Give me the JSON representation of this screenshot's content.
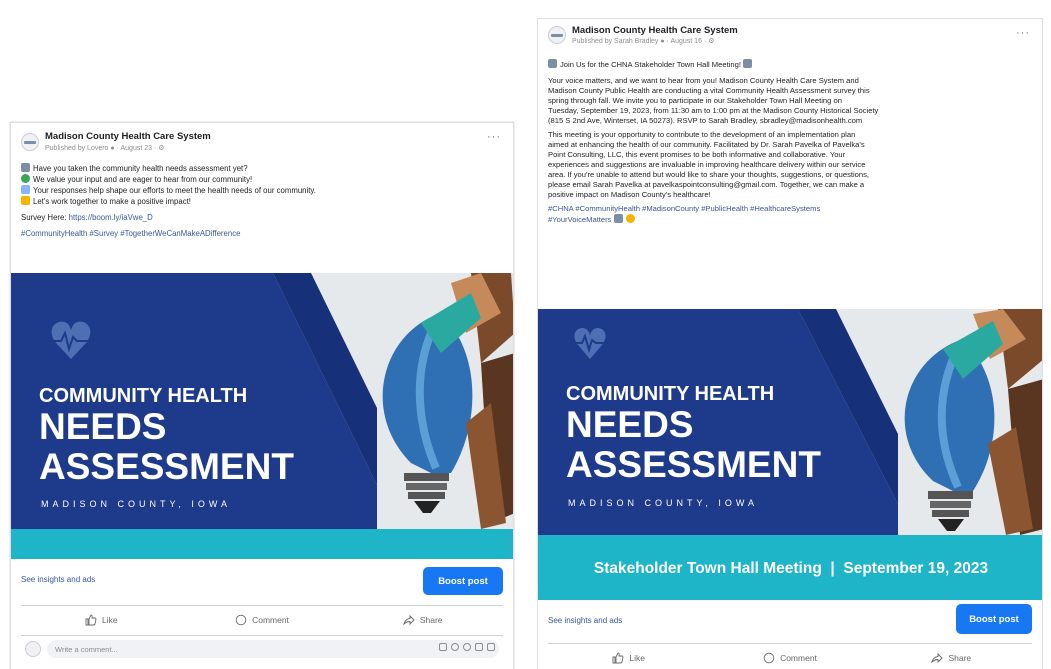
{
  "post1": {
    "page_name": "Madison County Health Care System",
    "published": "Published by",
    "publisher": "Lovero",
    "date": "August 23",
    "more": "···",
    "lines": [
      "Have you taken the community health needs assessment yet?",
      "We value your input and are eager to hear from our community!",
      "Your responses help shape our efforts to meet the health needs of our community.",
      "Let's work together to make a positive impact!"
    ],
    "survey_label": "Survey Here:",
    "survey_link": "https://boom.ly/iaVwe_D",
    "hashtags": "#CommunityHealth #Survey #TogetherWeCanMakeADifference",
    "banner": {
      "line1": "COMMUNITY HEALTH",
      "line2": "NEEDS",
      "line3": "ASSESSMENT",
      "line4": "MADISON COUNTY, IOWA"
    },
    "insights": "See insights and ads",
    "boost": "Boost post",
    "like": "Like",
    "comment": "Comment",
    "share": "Share",
    "comment_placeholder": "Write a comment..."
  },
  "post2": {
    "page_name": "Madison County Health Care System",
    "published": "Published by",
    "publisher": "Sarah Bradley",
    "date": "August 16",
    "more": "···",
    "headline": "Join Us for the CHNA Stakeholder Town Hall Meeting!",
    "para1": [
      "Your voice matters, and we want to hear from you! Madison County Health Care System and",
      "Madison County Public Health are conducting a vital Community Health Assessment survey this",
      "spring through fall. We invite you to participate in our Stakeholder Town Hall Meeting on",
      "Tuesday, September 19, 2023, from 11:30 am to 1:00 pm at the Madison County Historical Society",
      "(815 S 2nd Ave, Winterset, IA 50273).  RSVP to Sarah Bradley, sbradley@madisonhealth.com"
    ],
    "para2": [
      "This meeting is your opportunity to contribute to the development of an implementation plan",
      "aimed at enhancing the health of our community. Facilitated by Dr. Sarah Pavelka of Pavelka's",
      "Point Consulting, LLC, this event promises to be both informative and collaborative. Your",
      "experiences and suggestions are invaluable in improving healthcare delivery within our service",
      "area. If you're unable to attend but would like to share your thoughts, suggestions, or questions,",
      "please email Sarah Pavelka at pavelkaspointconsulting@gmail.com. Together, we can make a",
      "positive impact on Madison County's healthcare!"
    ],
    "hashtags1": "#CHNA #CommunityHealth #MadisonCounty #PublicHealth #HealthcareSystems",
    "hashtags2": "#YourVoiceMatters",
    "banner": {
      "line1": "COMMUNITY HEALTH",
      "line2": "NEEDS",
      "line3": "ASSESSMENT",
      "line4": "MADISON COUNTY, IOWA",
      "strip": "Stakeholder Town Hall Meeting  |  September 19, 2023"
    },
    "insights": "See insights and ads",
    "boost": "Boost post",
    "like": "Like",
    "comment": "Comment",
    "share": "Share"
  },
  "colors": {
    "navy": "#1e3a8a",
    "teal": "#1fb5c9",
    "facebook_blue": "#1877f2"
  }
}
